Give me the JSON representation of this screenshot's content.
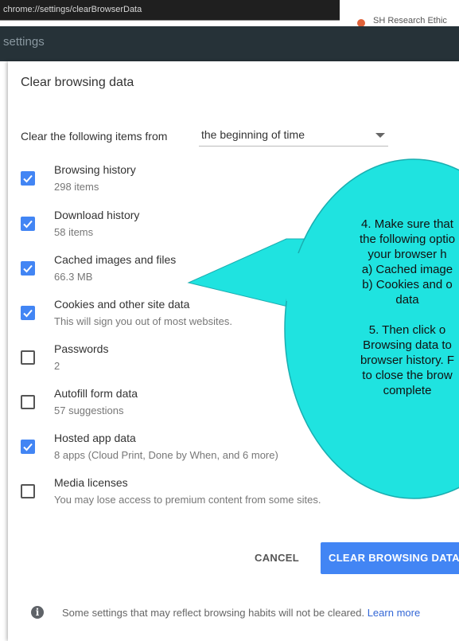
{
  "browser": {
    "url": "chrome://settings/clearBrowserData",
    "tab_partial": "SH Research Ethic"
  },
  "settings_header": {
    "title": "settings"
  },
  "dialog": {
    "title": "Clear browsing data",
    "from_label": "Clear the following items from",
    "time_range": "the beginning of time",
    "items": [
      {
        "title": "Browsing history",
        "sub": "298 items",
        "checked": true
      },
      {
        "title": "Download history",
        "sub": "58 items",
        "checked": true
      },
      {
        "title": "Cached images and files",
        "sub": "66.3 MB",
        "checked": true
      },
      {
        "title": "Cookies and other site data",
        "sub": "This will sign you out of most websites.",
        "checked": true
      },
      {
        "title": "Passwords",
        "sub": "2",
        "checked": false
      },
      {
        "title": "Autofill form data",
        "sub": "57 suggestions",
        "checked": false
      },
      {
        "title": "Hosted app data",
        "sub": "8 apps (Cloud Print, Done by When, and 6 more)",
        "checked": true
      },
      {
        "title": "Media licenses",
        "sub": "You may lose access to premium content from some sites.",
        "checked": false
      }
    ],
    "cancel_label": "CANCEL",
    "clear_label": "CLEAR BROWSING DATA",
    "footer_text": "Some settings that may reflect browsing habits will not be cleared.",
    "learn_more": "Learn more"
  },
  "callout": {
    "color": "#1fe3e0",
    "lines": [
      "4. Make sure that",
      "the following optio",
      "your browser h",
      "a) Cached image",
      "b) Cookies and o",
      "data",
      "",
      "5. Then click o",
      "Browsing data to",
      "browser history. F",
      "to close the brow",
      "complete"
    ]
  },
  "colors": {
    "accent": "#4285f4",
    "header_bg": "#263238"
  }
}
